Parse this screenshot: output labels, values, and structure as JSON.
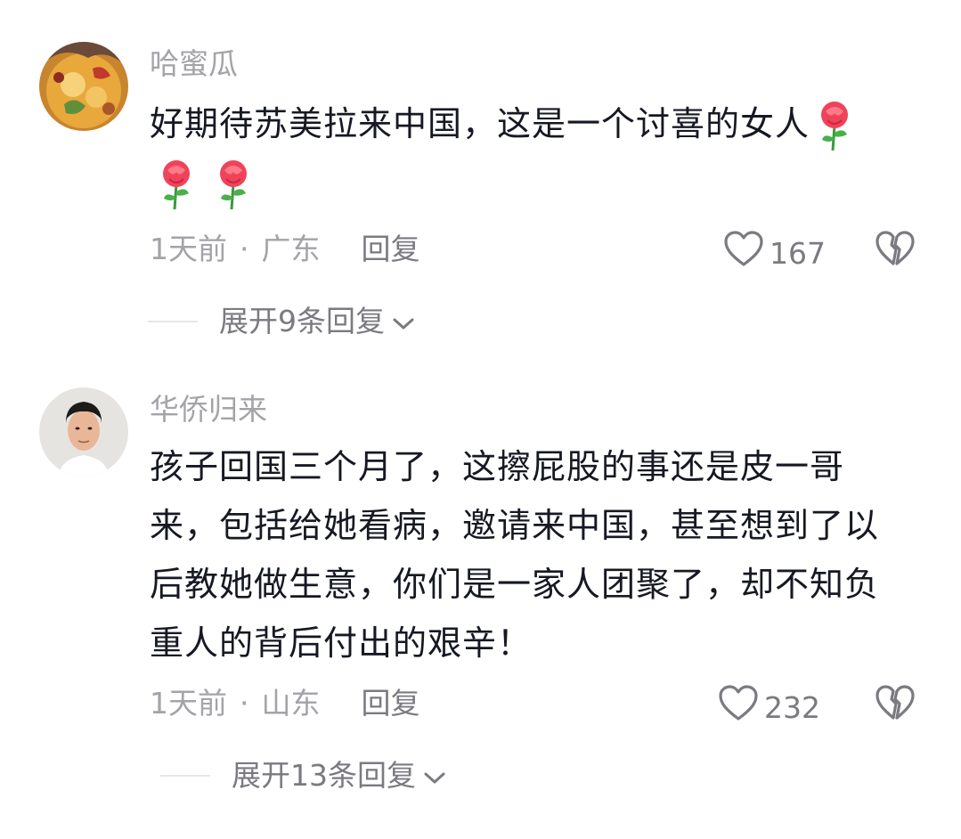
{
  "comments": [
    {
      "username": "哈蜜瓜",
      "text": "好期待苏美拉来中国，这是一个讨喜的女人",
      "emoji": "rose",
      "time": "1天前",
      "separator": "·",
      "location": "广东",
      "reply_label": "回复",
      "likes": "167",
      "expand_label": "展开9条回复"
    },
    {
      "username": "华侨归来",
      "text_lines": [
        "孩子回国三个月了，这擦屁股的事还是皮一哥",
        "来，包括给她看病，邀请来中国，甚至想到了以",
        "后教她做生意，你们是一家人团聚了，却不知负",
        "重人的背后付出的艰辛！"
      ],
      "time": "1天前",
      "separator": "·",
      "location": "山东",
      "reply_label": "回复",
      "likes": "232",
      "expand_label": "展开13条回复"
    }
  ],
  "icons": {
    "like": "heart-outline-icon",
    "dislike": "broken-heart-icon",
    "expand": "chevron-down-icon"
  },
  "colors": {
    "text_primary": "#161823",
    "text_secondary": "#a3a3a8",
    "text_action": "#7a7a80",
    "rose": "#f0435a"
  }
}
